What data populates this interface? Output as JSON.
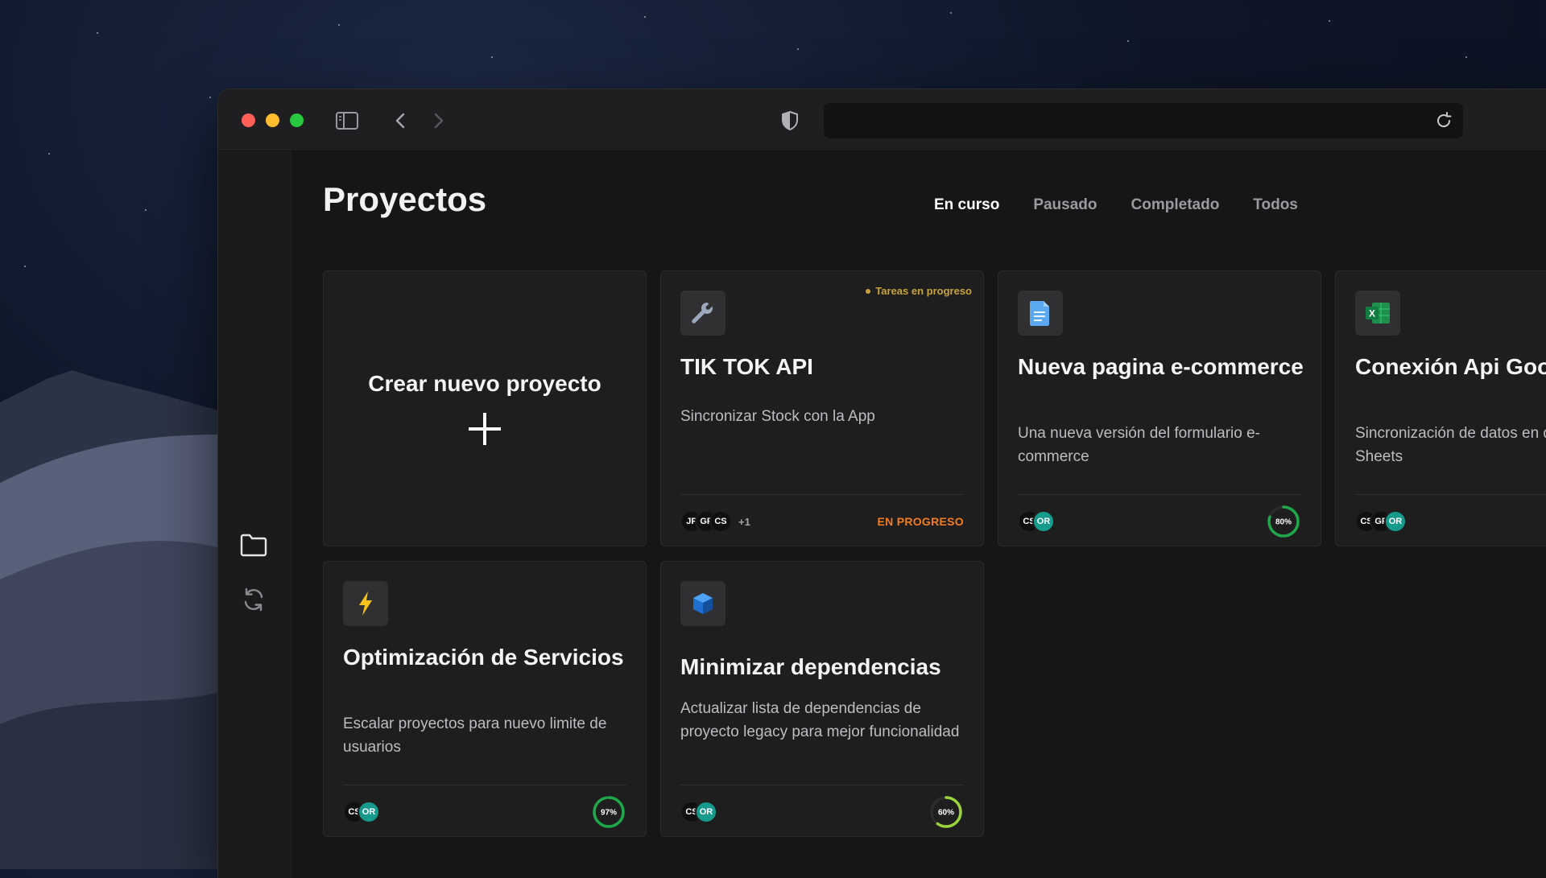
{
  "app": {
    "page_title": "Proyectos",
    "tabs": [
      {
        "label": "En curso",
        "active": true
      },
      {
        "label": "Pausado",
        "active": false
      },
      {
        "label": "Completado",
        "active": false
      },
      {
        "label": "Todos",
        "active": false
      }
    ]
  },
  "create_card": {
    "label": "Crear nuevo proyecto"
  },
  "projects": [
    {
      "icon": "wrench-icon",
      "title": "TIK TOK API",
      "description": "Sincronizar Stock con la App",
      "badge": "Tareas en progreso",
      "avatars": [
        "JP",
        "GF",
        "CS"
      ],
      "more_members": "+1",
      "status_label": "EN PROGRESO"
    },
    {
      "icon": "document-icon",
      "title": "Nueva pagina e-commerce",
      "description": "Una nueva versión del formulario e-commerce",
      "avatars": [
        "CS",
        "OR"
      ],
      "progress": "80%",
      "progress_value": 80
    },
    {
      "icon": "excel-icon",
      "title": "Conexión Api Goo Docs",
      "description": "Sincronización de datos en datos y Google Sheets",
      "avatars": [
        "CS",
        "GF",
        "OR"
      ]
    },
    {
      "icon": "lightning-icon",
      "title": "Optimización de Servicios",
      "description": "Escalar proyectos para nuevo limite de usuarios",
      "avatars": [
        "CS",
        "OR"
      ],
      "progress": "97%",
      "progress_value": 97
    },
    {
      "icon": "cube-icon",
      "title": "Minimizar dependencias",
      "description": "Actualizar lista de dependencias de proyecto legacy para mejor funcionalidad",
      "avatars": [
        "CS",
        "OR"
      ],
      "progress": "60%",
      "progress_value": 60
    }
  ],
  "colors": {
    "accent_green": "#1fa84a",
    "accent_lime": "#9bd43a",
    "status_orange": "#f47c20",
    "badge_gold": "#c9a23a",
    "avatar_teal": "#159a8c"
  }
}
